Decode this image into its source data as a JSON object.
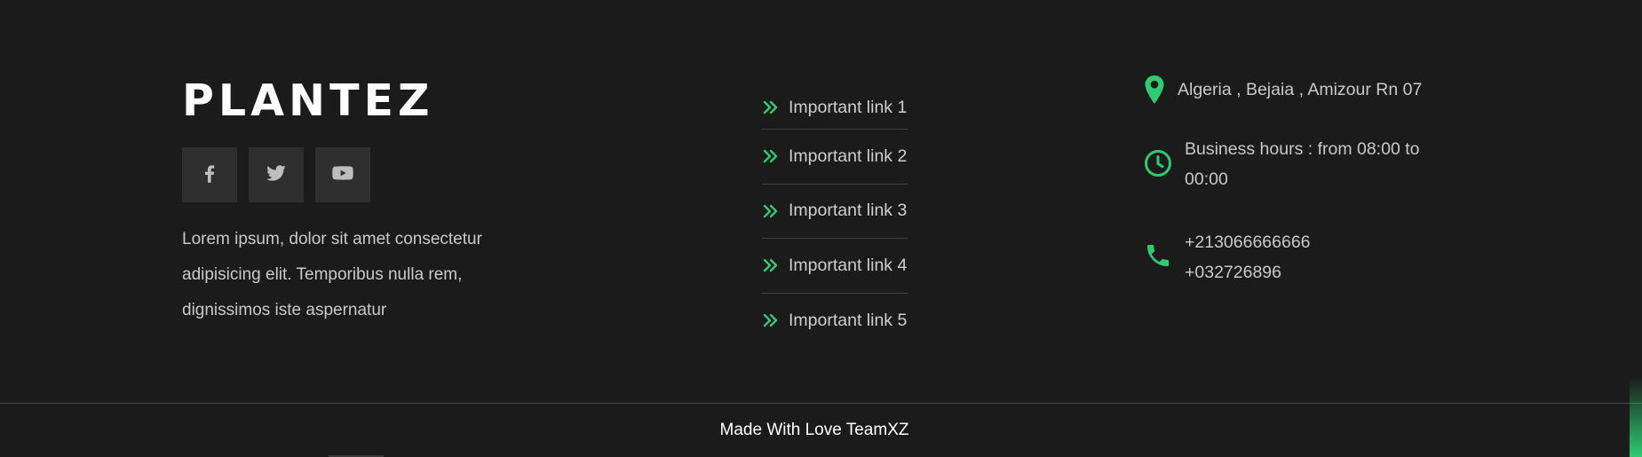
{
  "brand": {
    "name": "PLANTEZ"
  },
  "socials": [
    {
      "icon": "facebook-icon"
    },
    {
      "icon": "twitter-icon"
    },
    {
      "icon": "youtube-icon"
    }
  ],
  "about": "Lorem ipsum, dolor sit amet consectetur adipisicing elit. Temporibus nulla rem, dignissimos iste aspernatur",
  "links": [
    {
      "label": "Important link 1"
    },
    {
      "label": "Important link 2"
    },
    {
      "label": "Important link 3"
    },
    {
      "label": "Important link 4"
    },
    {
      "label": "Important link 5"
    }
  ],
  "contact": {
    "location": "Algeria , Bejaia , Amizour Rn 07",
    "hours": "Business hours : from 08:00 to 00:00",
    "phone_1": "+213066666666",
    "phone_2": "+032726896"
  },
  "credit": "Made With Love TeamXZ",
  "colors": {
    "accent": "#2ecc71",
    "background": "#1b1b1b",
    "social_tile": "#2e2e2e"
  }
}
